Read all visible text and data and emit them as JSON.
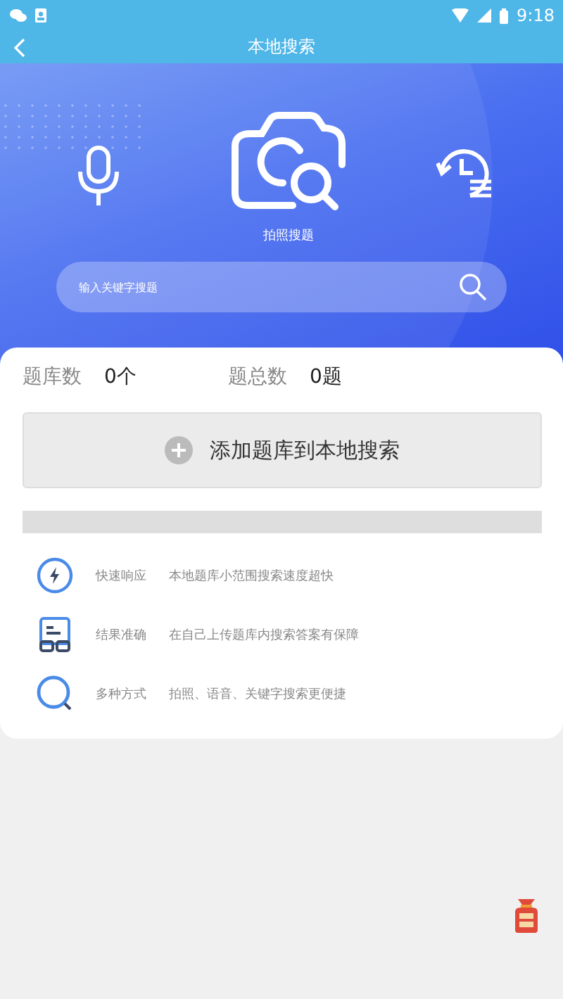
{
  "status_bar": {
    "time": "9:18"
  },
  "header": {
    "title": "本地搜索"
  },
  "hero": {
    "camera_label": "拍照搜题",
    "search": {
      "placeholder": "输入关键字搜题"
    }
  },
  "stats": [
    {
      "label": "题库数",
      "value": "0个"
    },
    {
      "label": "题总数",
      "value": "0题"
    }
  ],
  "add_button": {
    "label": "添加题库到本地搜索"
  },
  "features": [
    {
      "kind": "speed",
      "title": "快速响应",
      "description": "本地题库小范围搜索速度超快"
    },
    {
      "kind": "accuracy",
      "title": "结果准确",
      "description": "在自己上传题库内搜索答案有保障"
    },
    {
      "kind": "search",
      "title": "多种方式",
      "description": "拍照、语音、关键字搜索更便捷"
    }
  ]
}
